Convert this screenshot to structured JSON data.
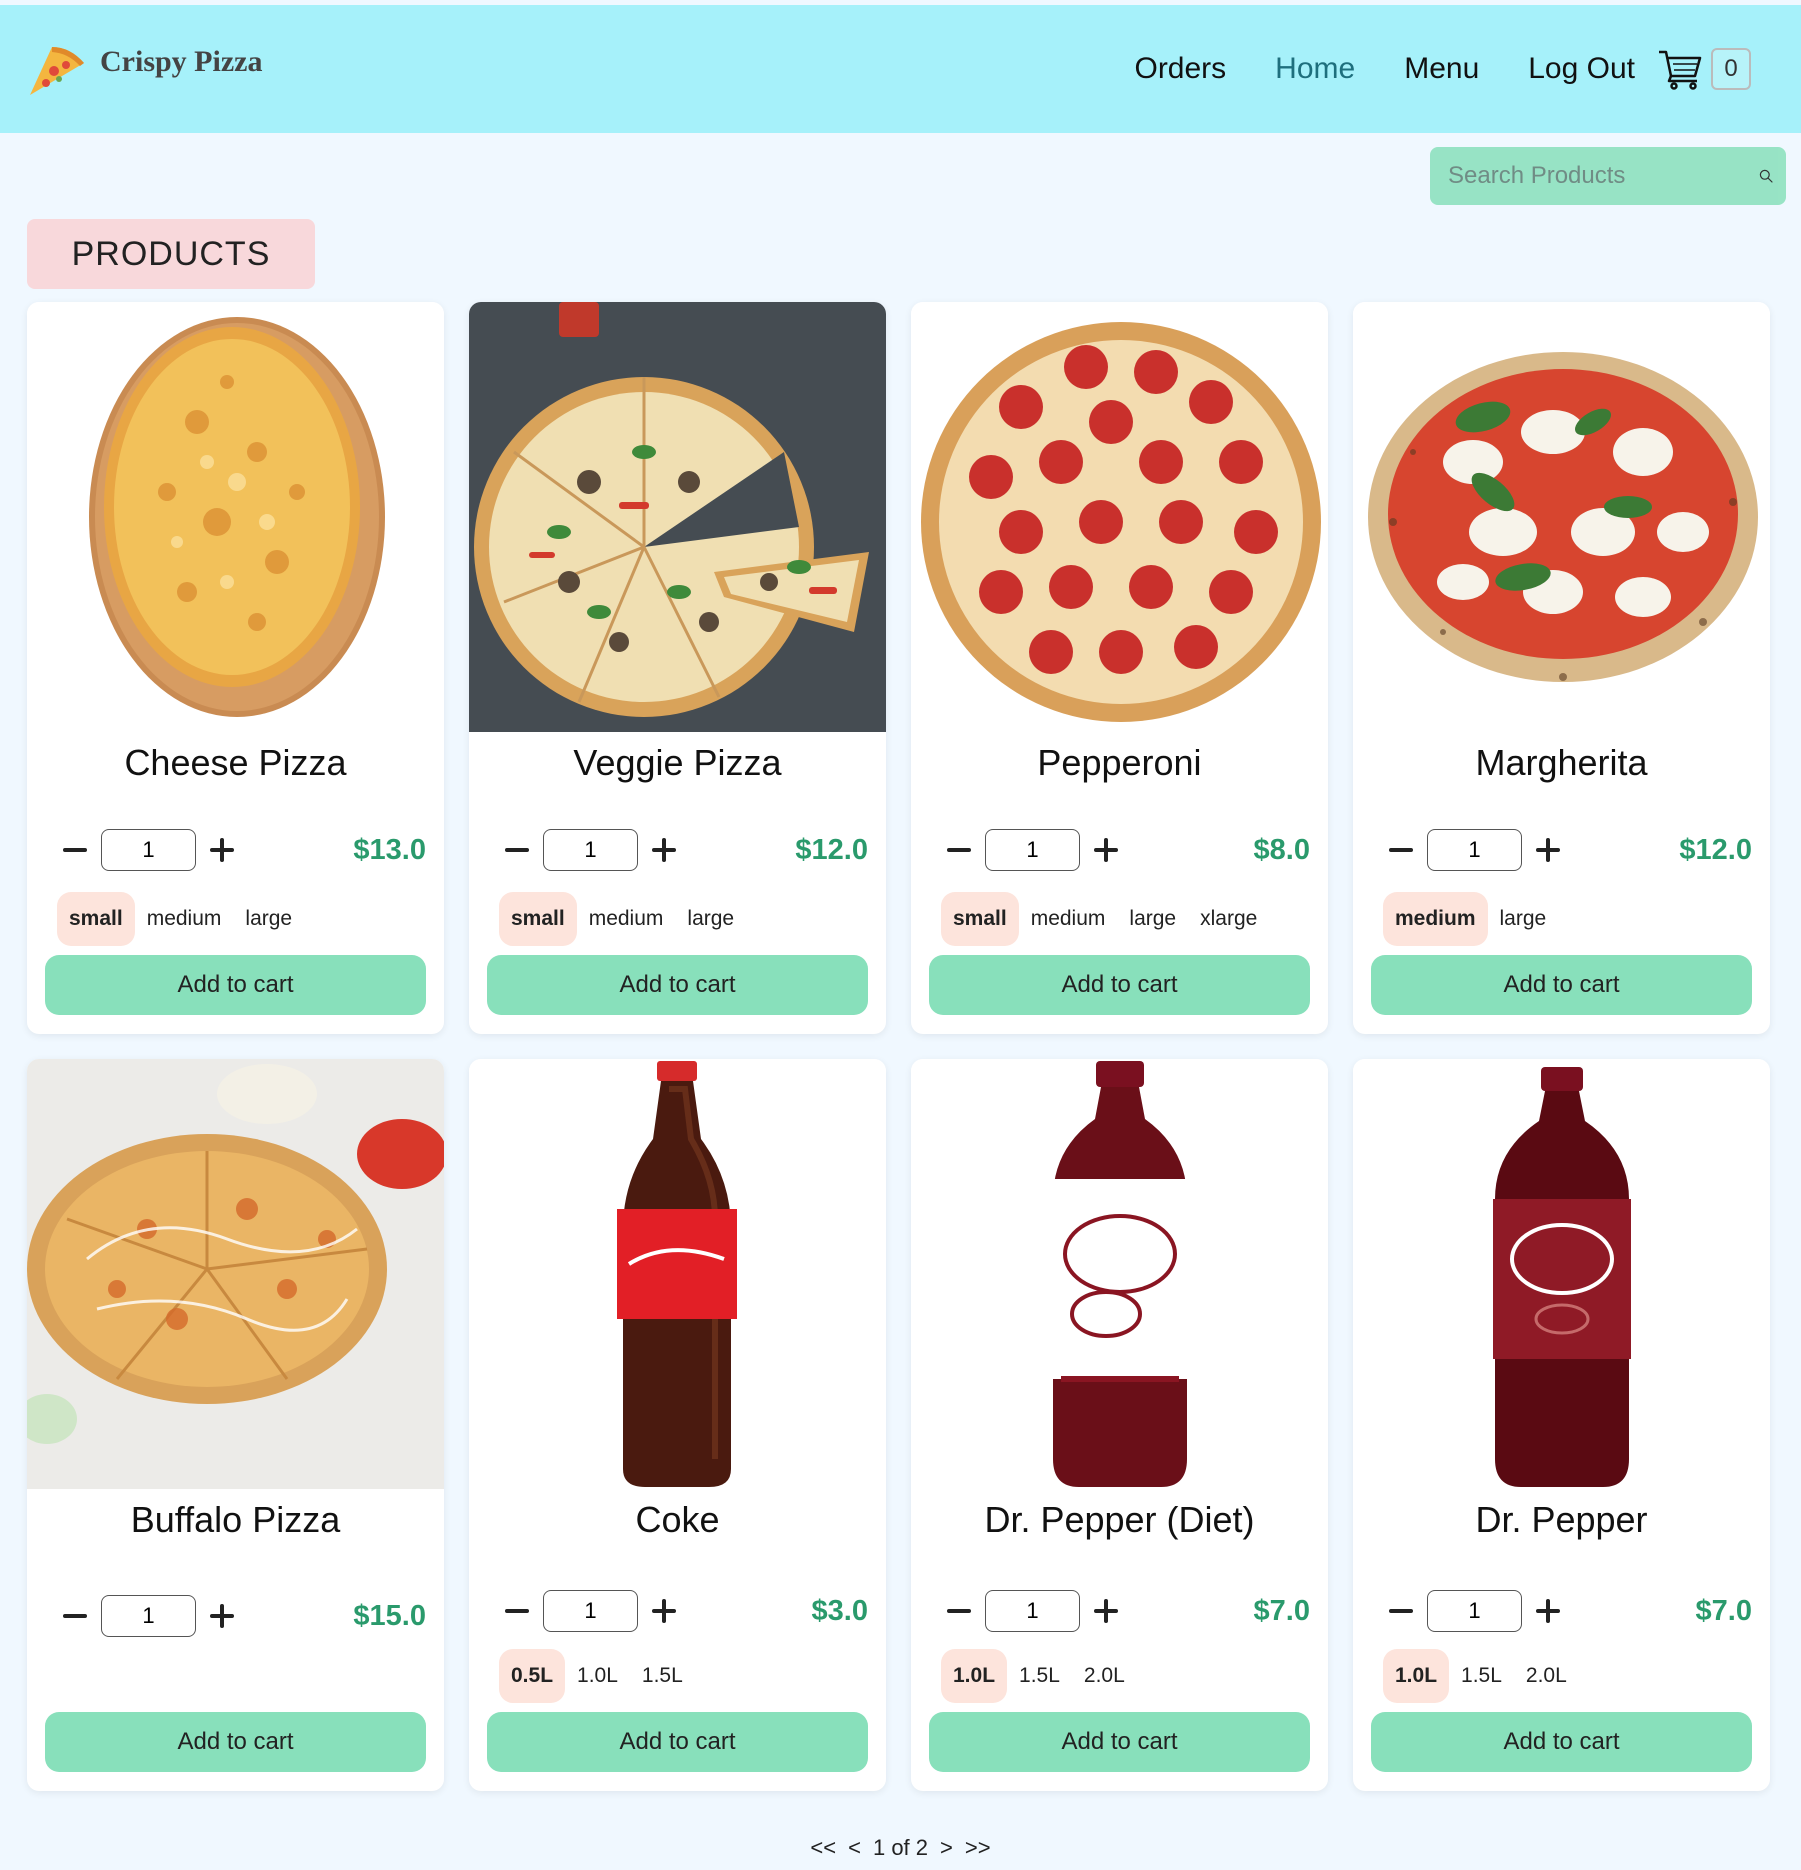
{
  "header": {
    "brand": "Crispy Pizza",
    "nav": [
      {
        "label": "Orders",
        "active": false
      },
      {
        "label": "Home",
        "active": true
      },
      {
        "label": "Menu",
        "active": false
      },
      {
        "label": "Log Out",
        "active": false
      }
    ],
    "cart_count": "0"
  },
  "search": {
    "placeholder": "Search Products"
  },
  "section_title": "PRODUCTS",
  "products": [
    {
      "name": "Cheese Pizza",
      "qty": "1",
      "price": "$13.0",
      "sizes": [
        "small",
        "medium",
        "large"
      ],
      "selected": "small",
      "add_label": "Add to cart",
      "image": "cheese-pizza-image"
    },
    {
      "name": "Veggie Pizza",
      "qty": "1",
      "price": "$12.0",
      "sizes": [
        "small",
        "medium",
        "large"
      ],
      "selected": "small",
      "add_label": "Add to cart",
      "image": "veggie-pizza-image"
    },
    {
      "name": "Pepperoni",
      "qty": "1",
      "price": "$8.0",
      "sizes": [
        "small",
        "medium",
        "large",
        "xlarge"
      ],
      "selected": "small",
      "add_label": "Add to cart",
      "image": "pepperoni-pizza-image"
    },
    {
      "name": "Margherita",
      "qty": "1",
      "price": "$12.0",
      "sizes": [
        "medium",
        "large"
      ],
      "selected": "medium",
      "add_label": "Add to cart",
      "image": "margherita-pizza-image"
    },
    {
      "name": "Buffalo Pizza",
      "qty": "1",
      "price": "$15.0",
      "sizes": [],
      "selected": "",
      "add_label": "Add to cart",
      "image": "buffalo-pizza-image"
    },
    {
      "name": "Coke",
      "qty": "1",
      "price": "$3.0",
      "sizes": [
        "0.5L",
        "1.0L",
        "1.5L"
      ],
      "selected": "0.5L",
      "add_label": "Add to cart",
      "image": "coke-bottle-image"
    },
    {
      "name": "Dr. Pepper (Diet)",
      "qty": "1",
      "price": "$7.0",
      "sizes": [
        "1.0L",
        "1.5L",
        "2.0L"
      ],
      "selected": "1.0L",
      "add_label": "Add to cart",
      "image": "diet-dr-pepper-bottle-image"
    },
    {
      "name": "Dr. Pepper",
      "qty": "1",
      "price": "$7.0",
      "sizes": [
        "1.0L",
        "1.5L",
        "2.0L"
      ],
      "selected": "1.0L",
      "add_label": "Add to cart",
      "image": "dr-pepper-bottle-image"
    }
  ],
  "pagination": {
    "first": "<<",
    "prev": "<",
    "text": "1 of 2",
    "next": ">",
    "last": ">>"
  },
  "colors": {
    "header_bg": "#a6f1fa",
    "accent_green": "#88e0bb",
    "price_green": "#2a9a6c",
    "title_pink": "#f8d8db",
    "selected_size": "#fde4dc",
    "page_bg": "#f0f8ff"
  }
}
